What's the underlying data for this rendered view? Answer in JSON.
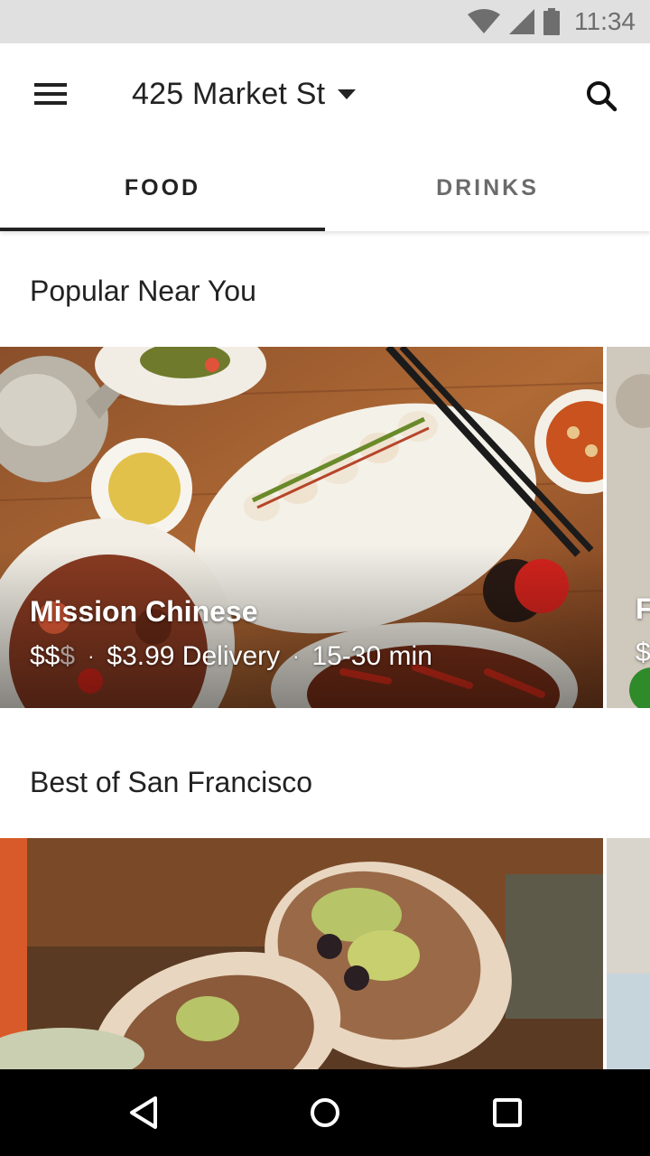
{
  "status_bar": {
    "time": "11:34",
    "icons": [
      "wifi-icon",
      "cellular-signal-icon",
      "battery-icon"
    ]
  },
  "app_bar": {
    "menu_icon": "hamburger-menu-icon",
    "address": "425 Market St",
    "address_dropdown_icon": "caret-down-icon",
    "search_icon": "search-icon"
  },
  "tabs": [
    {
      "label": "FOOD",
      "active": true
    },
    {
      "label": "DRINKS",
      "active": false
    }
  ],
  "sections": [
    {
      "title": "Popular Near You",
      "cards": [
        {
          "name": "Mission Chinese",
          "price_active": "$$",
          "price_inactive": "$",
          "separator": "·",
          "delivery_fee": "$3.99 Delivery",
          "eta": "15-30 min"
        }
      ],
      "peek_card": {
        "name_partial": "F",
        "meta_partial": "$"
      }
    },
    {
      "title": "Best of San Francisco",
      "cards": [
        {}
      ]
    }
  ],
  "nav_bar": {
    "icons": [
      "back-triangle-icon",
      "home-circle-icon",
      "recents-square-icon"
    ]
  },
  "colors": {
    "status_bar_bg": "#e0e0e0",
    "text_primary": "#222222",
    "tab_inactive": "#6b6b6b",
    "nav_bar_bg": "#000000"
  }
}
